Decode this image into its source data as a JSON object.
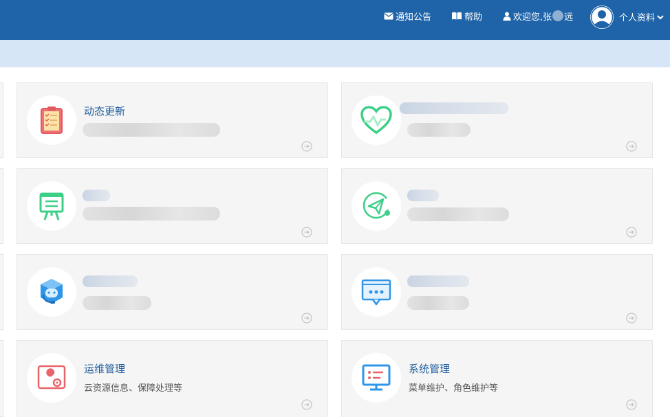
{
  "header": {
    "notice_label": "通知公告",
    "help_label": "帮助",
    "welcome_prefix": "欢迎您,张",
    "welcome_suffix": "远",
    "profile_label": "个人资料"
  },
  "cards": [
    {
      "title": "动态更新",
      "desc": "",
      "icon": "clipboard-checklist-icon",
      "accent": "#e8646a"
    },
    {
      "title": "",
      "desc": "",
      "icon": "heart-pulse-icon",
      "accent": "#3ccf88"
    },
    {
      "title": "",
      "desc": "",
      "icon": "presentation-board-icon",
      "accent": "#3ccf88"
    },
    {
      "title": "",
      "desc": "",
      "icon": "paper-plane-icon",
      "accent": "#3ccf88"
    },
    {
      "title": "",
      "desc": "",
      "icon": "support-cube-icon",
      "accent": "#2f95e8"
    },
    {
      "title": "",
      "desc": "",
      "icon": "chat-window-icon",
      "accent": "#2f95e8"
    },
    {
      "title": "运维管理",
      "desc": "云资源信息、保障处理等",
      "icon": "wrench-gear-icon",
      "accent": "#e8646a"
    },
    {
      "title": "系统管理",
      "desc": "菜单维护、角色维护等",
      "icon": "monitor-settings-icon",
      "accent": "#2f95e8"
    }
  ],
  "colors": {
    "header_bg": "#1f64a8",
    "subbar_bg": "#d6e6f6",
    "card_bg": "#f5f5f5",
    "title_color": "#1f5e9e"
  }
}
